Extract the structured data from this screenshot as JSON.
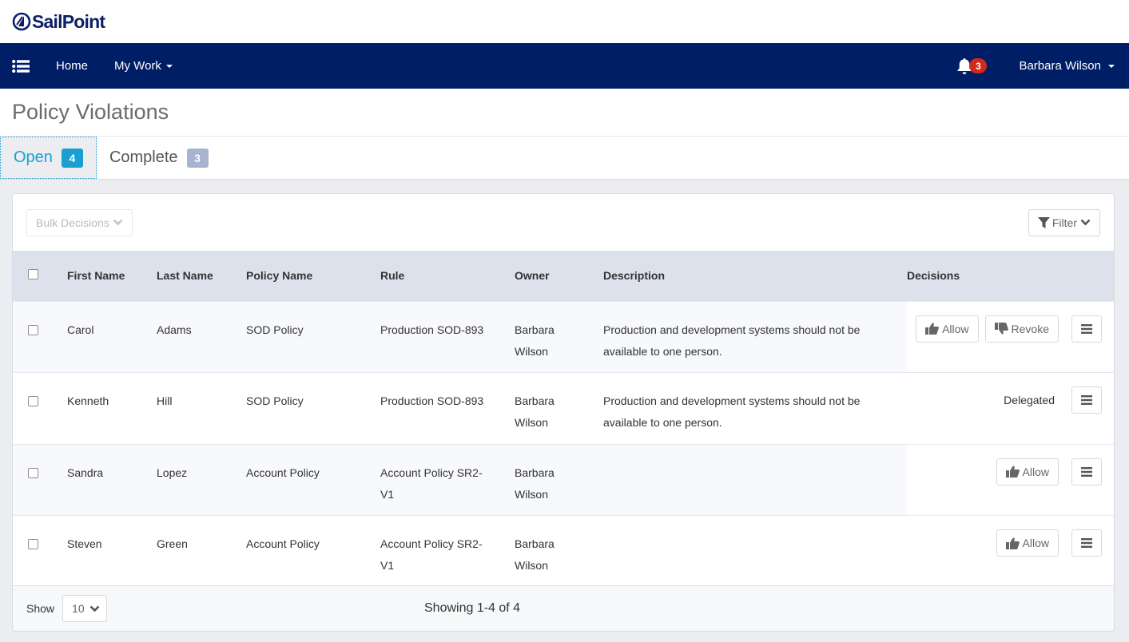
{
  "brand": {
    "name": "SailPoint"
  },
  "navbar": {
    "menu_icon": "list-icon",
    "links": [
      {
        "label": "Home",
        "has_dropdown": false
      },
      {
        "label": "My Work",
        "has_dropdown": true
      }
    ],
    "notifications": {
      "icon": "bell-icon",
      "count": "3"
    },
    "user": {
      "name": "Barbara Wilson"
    }
  },
  "page": {
    "title": "Policy Violations"
  },
  "tabs": [
    {
      "label": "Open",
      "count": "4",
      "active": true
    },
    {
      "label": "Complete",
      "count": "3",
      "active": false
    }
  ],
  "toolbar": {
    "bulk_decisions_label": "Bulk Decisions",
    "filter_label": "Filter"
  },
  "table": {
    "columns": [
      "First Name",
      "Last Name",
      "Policy Name",
      "Rule",
      "Owner",
      "Description",
      "Decisions"
    ],
    "rows": [
      {
        "first_name": "Carol",
        "last_name": "Adams",
        "policy_name": "SOD Policy",
        "rule": "Production SOD-893",
        "owner": "Barbara Wilson",
        "description": "Production and development systems should not be available to one person.",
        "decision": {
          "type": "buttons",
          "allow_label": "Allow",
          "revoke_label": "Revoke"
        }
      },
      {
        "first_name": "Kenneth",
        "last_name": "Hill",
        "policy_name": "SOD Policy",
        "rule": "Production SOD-893",
        "owner": "Barbara Wilson",
        "description": "Production and development systems should not be available to one person.",
        "decision": {
          "type": "status",
          "status_label": "Delegated"
        }
      },
      {
        "first_name": "Sandra",
        "last_name": "Lopez",
        "policy_name": "Account Policy",
        "rule": "Account Policy SR2-V1",
        "owner": "Barbara Wilson",
        "description": "",
        "decision": {
          "type": "allow-only",
          "allow_label": "Allow"
        }
      },
      {
        "first_name": "Steven",
        "last_name": "Green",
        "policy_name": "Account Policy",
        "rule": "Account Policy SR2-V1",
        "owner": "Barbara Wilson",
        "description": "",
        "decision": {
          "type": "allow-only",
          "allow_label": "Allow"
        }
      }
    ]
  },
  "footer": {
    "show_label": "Show",
    "page_size": "10",
    "showing_text": "Showing 1-4 of 4"
  },
  "colors": {
    "navbar": "#001e66",
    "accent": "#1a9fd1",
    "notification_badge": "#d2291c",
    "muted_badge": "#a8b3d0",
    "table_header": "#dde1ec"
  }
}
